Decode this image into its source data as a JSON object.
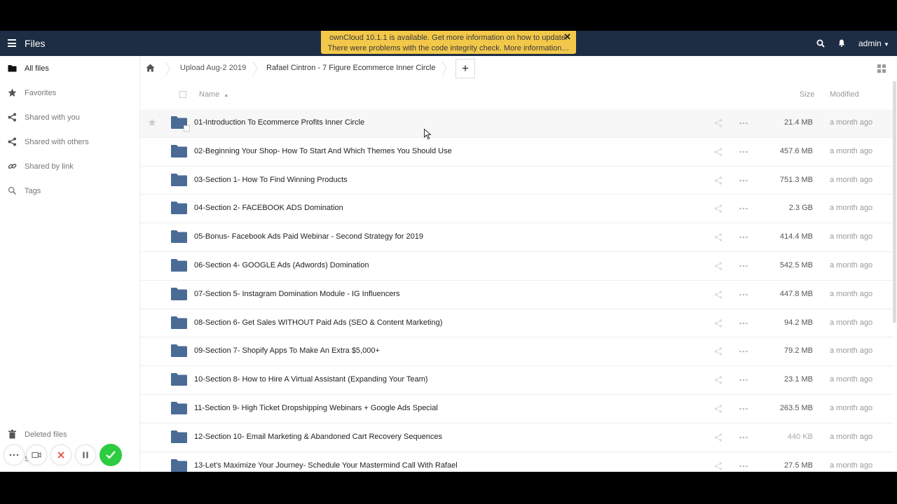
{
  "header": {
    "app_title": "Files",
    "user": "admin",
    "notice_line1": "ownCloud 10.1.1 is available. Get more information on how to update.",
    "notice_line2": "There were problems with the code integrity check. More information…",
    "notice_close": "✕",
    "icons": [
      "menu-icon",
      "search-icon",
      "bell-icon"
    ]
  },
  "sidebar": {
    "items": [
      {
        "label": "All files",
        "icon": "folder-icon"
      },
      {
        "label": "Favorites",
        "icon": "star-icon"
      },
      {
        "label": "Shared with you",
        "icon": "share-icon"
      },
      {
        "label": "Shared with others",
        "icon": "share-icon"
      },
      {
        "label": "Shared by link",
        "icon": "link-icon"
      },
      {
        "label": "Tags",
        "icon": "search-icon"
      }
    ],
    "deleted": "Deleted files",
    "settings_partial": "S"
  },
  "breadcrumb": {
    "items": [
      "Upload Aug-2 2019",
      "Rafael Cintron - 7 Figure Ecommerce Inner Circle"
    ],
    "add_label": "+"
  },
  "table": {
    "col_name": "Name",
    "col_size": "Size",
    "col_modified": "Modified",
    "rows": [
      {
        "name": "01-Introduction To Ecommerce Profits Inner Circle",
        "size": "21.4 MB",
        "modified": "a month ago"
      },
      {
        "name": "02-Beginning Your Shop- How To Start And Which Themes You Should Use",
        "size": "457.6 MB",
        "modified": "a month ago"
      },
      {
        "name": "03-Section 1- How To Find Winning Products",
        "size": "751.3 MB",
        "modified": "a month ago"
      },
      {
        "name": "04-Section 2- FACEBOOK ADS Domination",
        "size": "2.3 GB",
        "modified": "a month ago"
      },
      {
        "name": "05-Bonus- Facebook Ads Paid Webinar - Second Strategy for 2019",
        "size": "414.4 MB",
        "modified": "a month ago"
      },
      {
        "name": "06-Section 4- GOOGLE Ads (Adwords) Domination",
        "size": "542.5 MB",
        "modified": "a month ago"
      },
      {
        "name": "07-Section 5- Instagram Domination Module - IG Influencers",
        "size": "447.8 MB",
        "modified": "a month ago"
      },
      {
        "name": "08-Section 6- Get Sales WITHOUT Paid Ads (SEO & Content Marketing)",
        "size": "94.2 MB",
        "modified": "a month ago"
      },
      {
        "name": "09-Section 7- Shopify Apps To Make An Extra $5,000+",
        "size": "79.2 MB",
        "modified": "a month ago"
      },
      {
        "name": "10-Section 8- How to Hire A Virtual Assistant (Expanding Your Team)",
        "size": "23.1 MB",
        "modified": "a month ago"
      },
      {
        "name": "11-Section 9- High Ticket Dropshipping Webinars + Google Ads Special",
        "size": "263.5 MB",
        "modified": "a month ago"
      },
      {
        "name": "12-Section 10- Email Marketing & Abandoned Cart Recovery Sequences",
        "size": "440 KB",
        "modified": "a month ago"
      },
      {
        "name": "13-Let's Maximize Your Journey- Schedule Your Mastermind Call With Rafael",
        "size": "27.5 MB",
        "modified": "a month ago"
      }
    ]
  },
  "colors": {
    "header_bg": "#1d2d44",
    "notice_bg": "#f3c84a",
    "folder": "#4a6b95",
    "confirm": "#2ecc40",
    "cancel": "#e74c3c"
  }
}
